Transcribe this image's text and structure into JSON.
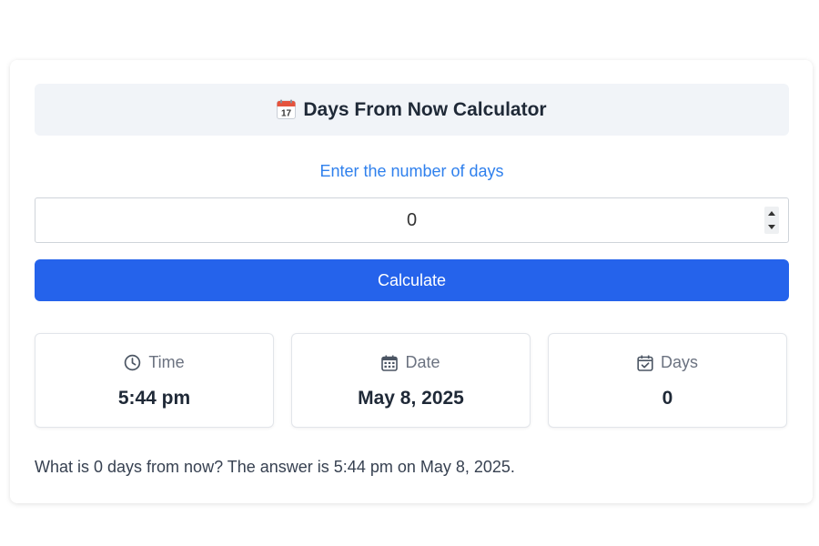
{
  "header": {
    "icon": "calendar-emoji-icon",
    "title": "Days From Now Calculator"
  },
  "prompt": "Enter the number of days",
  "input": {
    "value": "0"
  },
  "calculate_button": "Calculate",
  "results": [
    {
      "icon": "clock-icon",
      "label": "Time",
      "value": "5:44 pm"
    },
    {
      "icon": "calendar-grid-icon",
      "label": "Date",
      "value": "May 8, 2025"
    },
    {
      "icon": "calendar-check-icon",
      "label": "Days",
      "value": "0"
    }
  ],
  "answer": "What is 0 days from now? The answer is 5:44 pm on May 8, 2025.",
  "colors": {
    "accent": "#2563eb",
    "prompt_text": "#2f80ed",
    "header_bg": "#f1f4f8",
    "muted_text": "#6b7280"
  }
}
